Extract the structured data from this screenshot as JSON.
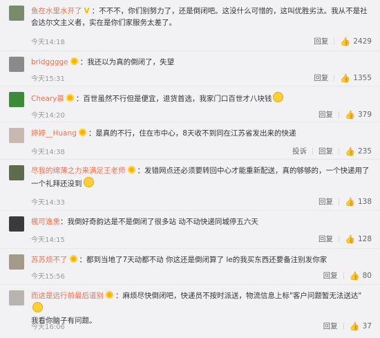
{
  "comments": [
    {
      "user": "鱼在水里水开了",
      "badge": "V",
      "text": "：不不不，你们别努力了，还是倒闭吧。这没什么可惜的，这叫优胜劣汰。我从不是社会达尔文主义者，实在是你们家服务太差了。",
      "time": "今天14:18",
      "reply": "回复",
      "likes": "2429",
      "avatar_color": "#7a8a6d"
    },
    {
      "user": "bridgggge",
      "text": "：我还以为真的倒闭了，失望",
      "time": "今天15:31",
      "reply": "回复",
      "likes": "1355",
      "avatar_color": "#8a8a8a"
    },
    {
      "user": "Cheary慕",
      "text": "：百世虽然不行但是便宜，退货首选，我家门口百世才八块钱",
      "time": "今天14:20",
      "reply": "回复",
      "likes": "379",
      "avatar_color": "#3d8a3a"
    },
    {
      "user": "婷婷__Huang",
      "text": "：是真的不行，住在市中心，8天收不到同在江苏省发出来的快递",
      "time": "今天14:38",
      "report": "投诉",
      "reply": "回复",
      "likes": "235",
      "avatar_color": "#c9b8b0"
    },
    {
      "user": "尽我的绵薄之力来满足王老师",
      "text": "：发错网点还必须要转回中心才能重新配送，真的够够的，一个快递用了一个礼拜还没到",
      "time": "今天14:33",
      "reply": "回复",
      "likes": "138",
      "avatar_color": "#5e6b4f"
    },
    {
      "user": "楓可逸熏",
      "text": "：我倒好奇韵达是不是倒闭了很多站 动不动快递同城停五六天",
      "time": "今天14:15",
      "reply": "回复",
      "likes": "128",
      "avatar_color": "#3a3a3a"
    },
    {
      "user": "苏苏烦不了",
      "text": "：都到当地了7天动都不动 你这还是倒闭算了 le的我买东西还要备注别发你家",
      "time": "今天15:56",
      "reply": "回复",
      "likes": "80",
      "avatar_color": "#a39a8c"
    },
    {
      "user": "而这是远行前最后道别",
      "text": "：麻烦尽快倒闭吧，快递员不按时派送，物流信息上标\"客户问题暂无法送达\"",
      "text2": "我看你脑子有问题。",
      "time": "今天16:06",
      "reply": "回复",
      "likes": "37",
      "avatar_color": "#b7b3ae"
    }
  ]
}
